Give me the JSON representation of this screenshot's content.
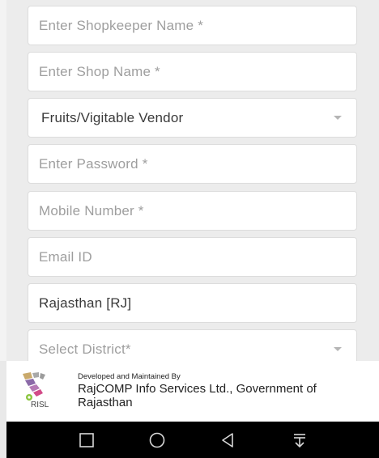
{
  "form": {
    "shopkeeper_name_placeholder": "Enter Shopkeeper Name *",
    "shop_name_placeholder": "Enter Shop Name *",
    "vendor_type_value": "Fruits/Vigitable Vendor",
    "password_placeholder": "Enter Password *",
    "mobile_placeholder": "Mobile Number *",
    "email_placeholder": "Email ID",
    "state_value": "Rajasthan [RJ]",
    "district_placeholder": "Select District*"
  },
  "footer": {
    "logo_text": "RISL",
    "developed_label": "Developed and Maintained By",
    "org_name": "RajCOMP Info Services Ltd., Government of Rajasthan"
  },
  "navbar": {
    "icons": [
      "square-icon",
      "circle-icon",
      "back-triangle-icon",
      "notification-down-icon"
    ]
  }
}
